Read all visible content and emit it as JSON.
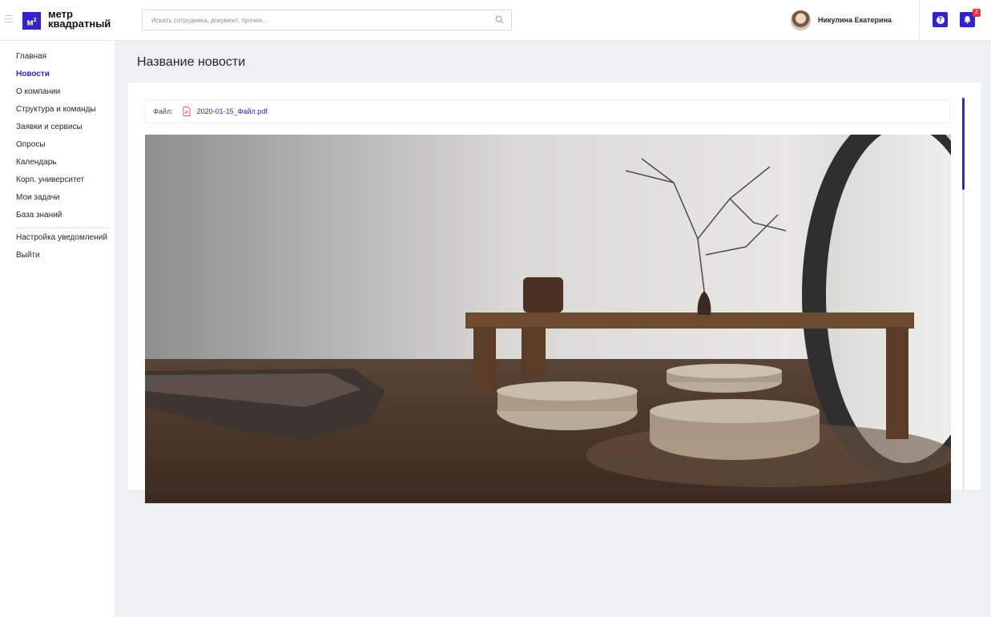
{
  "header": {
    "logo_mark": "м",
    "logo_mark_sup": "2",
    "logo_line1": "метр",
    "logo_line2": "квадратный",
    "search_placeholder": "Искать сотрудника, документ, прочее...",
    "search_value": "",
    "user_name": "Никулина Екатерина",
    "help_symbol": "?",
    "notifications_count": "2"
  },
  "sidebar": {
    "items": [
      {
        "label": "Главная",
        "active": false
      },
      {
        "label": "Новости",
        "active": true
      },
      {
        "label": "О компании",
        "active": false
      },
      {
        "label": "Структура и команды",
        "active": false
      },
      {
        "label": "Заявки и сервисы",
        "active": false
      },
      {
        "label": "Опросы",
        "active": false
      },
      {
        "label": "Календарь",
        "active": false
      },
      {
        "label": "Корп. университет",
        "active": false
      },
      {
        "label": "Мои задачи",
        "active": false
      },
      {
        "label": "База знаний",
        "active": false
      }
    ],
    "bottom_items": [
      {
        "label": "Настройка уведомлений"
      },
      {
        "label": "Выйти"
      }
    ]
  },
  "main": {
    "title": "Название новости",
    "file_label": "Файл:",
    "file_name": "2020-01-15_Файл.pdf"
  },
  "colors": {
    "accent": "#3424c8",
    "badge": "#e8323c",
    "background": "#eef1f4"
  }
}
